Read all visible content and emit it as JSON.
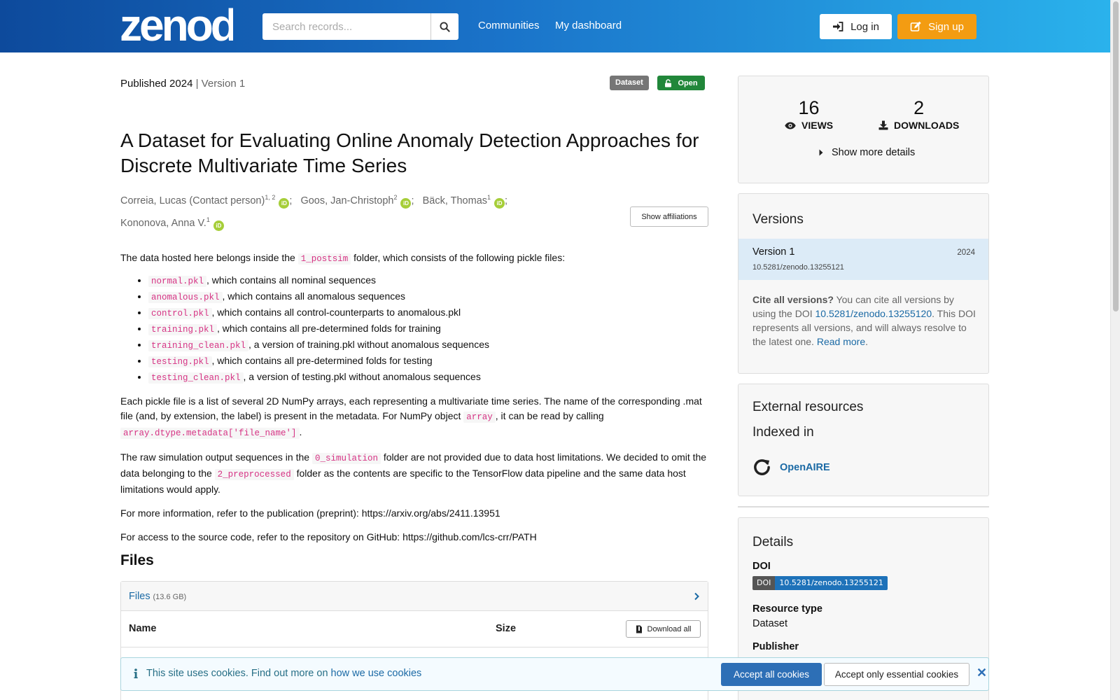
{
  "header": {
    "logo_text": "zenodo",
    "search_placeholder": "Search records...",
    "nav": [
      "Communities",
      "My dashboard"
    ],
    "login_label": "Log in",
    "signup_label": "Sign up",
    "accent_orange": "#f39c12"
  },
  "record": {
    "published": "Published 2024",
    "separator": "|",
    "version": "Version 1",
    "badge_type": "Dataset",
    "badge_access": "Open",
    "title": "A Dataset for Evaluating Online Anomaly Detection Approaches for Discrete Multivariate Time Series",
    "authors": [
      {
        "name": "Correia, Lucas (Contact person)",
        "aff": "1, 2",
        "sep": ";"
      },
      {
        "name": "Goos, Jan-Christoph",
        "aff": "2",
        "sep": ";"
      },
      {
        "name": "Bäck, Thomas",
        "aff": "1",
        "sep": ";"
      },
      {
        "name": "Kononova, Anna V.",
        "aff": "1",
        "sep": ""
      }
    ],
    "orcid_label": "iD",
    "show_affiliations_label": "Show affiliations"
  },
  "description": {
    "intro_pre": "The data hosted here belongs inside the",
    "intro_code": "1_postsim",
    "intro_post": "folder, which consists of the following pickle files:",
    "files": [
      {
        "code": "normal.pkl",
        "text": ", which contains all nominal sequences"
      },
      {
        "code": "anomalous.pkl",
        "text": ", which contains all anomalous sequences"
      },
      {
        "code": "control.pkl",
        "text": ", which contains all control-counterparts to anomalous.pkl"
      },
      {
        "code": "training.pkl",
        "text": ", which contains all pre-determined folds for training"
      },
      {
        "code": "training_clean.pkl",
        "text": ", a version of training.pkl without anomalous sequences"
      },
      {
        "code": "testing.pkl",
        "text": ", which contains all pre-determined folds for testing"
      },
      {
        "code": "testing_clean.pkl",
        "text": ", a version of testing.pkl without anomalous sequences"
      }
    ],
    "p2_a": "Each pickle file is a list of several 2D NumPy arrays, each representing a multivariate time series. The name of the corresponding .mat file (and, by extension, the label) is present in the metadata. For NumPy object",
    "p2_code1": "array",
    "p2_b": ", it can be read by calling",
    "p2_code2": "array.dtype.metadata['file_name']",
    "p2_c": ".",
    "p3_a": "The raw simulation output sequences in the",
    "p3_code1": "0_simulation",
    "p3_b": "folder are not provided due to data host limitations. We decided to omit the data belonging to the",
    "p3_code2": "2_preprocessed",
    "p3_c": "folder as the contents are specific to the TensorFlow data pipeline and the same data host limitations would apply.",
    "p4": "For more information, refer to the publication (preprint): https://arxiv.org/abs/2411.13951",
    "p5": "For access to the source code, refer to the repository on GitHub: https://github.com/lcs-crr/PATH"
  },
  "files": {
    "heading": "Files",
    "panel_label": "Files",
    "panel_size": "(13.6 GB)",
    "col_name": "Name",
    "col_size": "Size",
    "download_all": "Download all"
  },
  "sidebar": {
    "views_count": "16",
    "views_label": "VIEWS",
    "downloads_count": "2",
    "downloads_label": "DOWNLOADS",
    "show_more": "Show more details",
    "versions_title": "Versions",
    "version_row": {
      "label": "Version 1",
      "year": "2024",
      "doi": "10.5281/zenodo.13255121"
    },
    "cite_bold": "Cite all versions?",
    "cite_a": "You can cite all versions by using the DOI",
    "cite_doi": "10.5281/zenodo.13255120",
    "cite_b": ". This DOI represents all versions, and will always resolve to the latest one.",
    "cite_link": "Read more",
    "cite_end": ".",
    "external_title": "External resources",
    "indexed_title": "Indexed in",
    "openaire": "OpenAIRE",
    "details_title": "Details",
    "doi_label": "DOI",
    "doi_badge_a": "DOI",
    "doi_badge_b": "10.5281/zenodo.13255121",
    "resource_type_label": "Resource type",
    "resource_type": "Dataset",
    "publisher_label": "Publisher"
  },
  "cookies": {
    "text": "This site uses cookies. Find out more on",
    "link": "how we use cookies",
    "accept_all": "Accept all cookies",
    "accept_essential": "Accept only essential cookies"
  }
}
